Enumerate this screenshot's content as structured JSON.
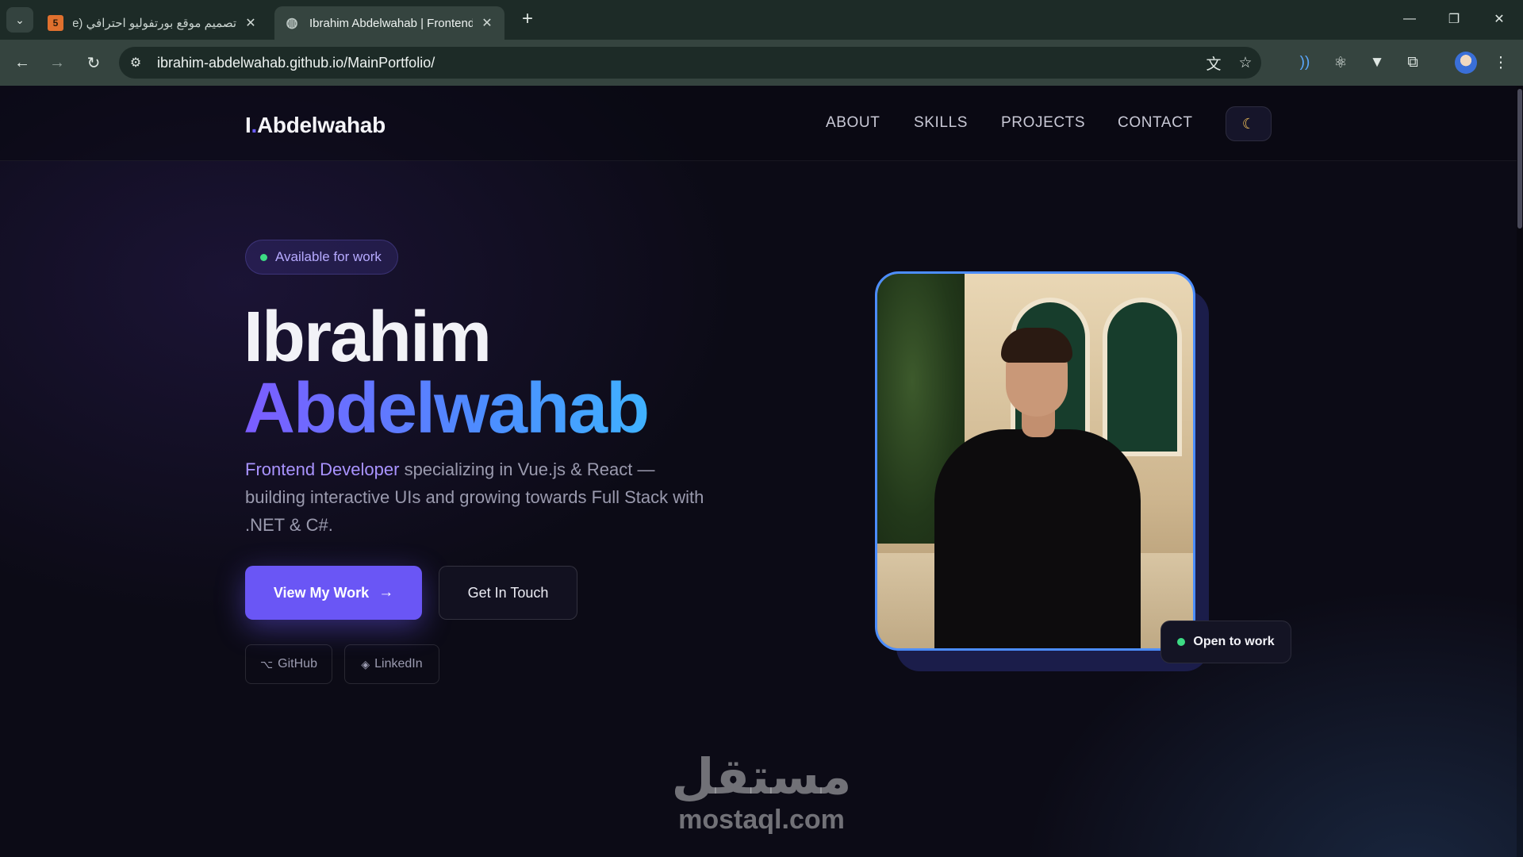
{
  "browser": {
    "tabs": [
      {
        "title": "تصميم موقع بورتفوليو احترافي (e",
        "favicon": "5"
      },
      {
        "title": "Ibrahim Abdelwahab | Frontend",
        "favicon": "globe-icon"
      }
    ],
    "url": "ibrahim-abdelwahab.github.io/MainPortfolio/"
  },
  "site": {
    "logo_initial": "I",
    "logo_dot": ".",
    "logo_name": "Abdelwahab",
    "nav": [
      "ABOUT",
      "SKILLS",
      "PROJECTS",
      "CONTACT"
    ],
    "theme_icon": "moon-icon"
  },
  "hero": {
    "badge": "Available for work",
    "first_name": "Ibrahim",
    "last_name": "Abdelwahab",
    "role": "Frontend Developer",
    "description": " specializing in Vue.js & React — building interactive UIs and growing towards Full Stack with .NET & C#.",
    "primary_button": "View My Work",
    "secondary_button": "Get In Touch",
    "social": [
      {
        "icon": "⌥",
        "label": "GitHub"
      },
      {
        "icon": "◈",
        "label": "LinkedIn"
      }
    ],
    "photo_badge": "Open to work"
  },
  "watermark": {
    "arabic": "مستقل",
    "latin": "mostaql.com"
  },
  "colors": {
    "accent": "#6a56f5",
    "gradient_start": "#7c5cff",
    "gradient_end": "#3fb2ff",
    "status_green": "#3ddc84",
    "background": "#0c0b16"
  }
}
